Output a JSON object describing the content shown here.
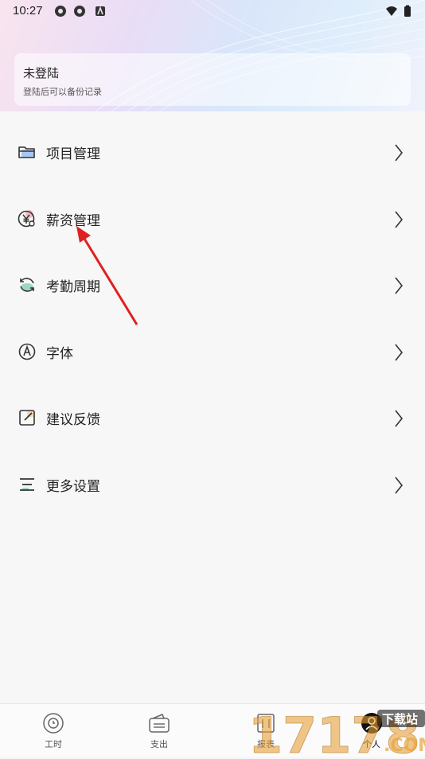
{
  "status_bar": {
    "time": "10:27"
  },
  "profile": {
    "title": "未登陆",
    "subtitle": "登陆后可以备份记录"
  },
  "menu": [
    {
      "label": "项目管理",
      "icon": "folder-icon"
    },
    {
      "label": "薪资管理",
      "icon": "yen-coin-icon"
    },
    {
      "label": "考勤周期",
      "icon": "cycle-icon"
    },
    {
      "label": "字体",
      "icon": "font-a-icon"
    },
    {
      "label": "建议反馈",
      "icon": "edit-note-icon"
    },
    {
      "label": "更多设置",
      "icon": "settings-lines-icon"
    }
  ],
  "bottom_nav": [
    {
      "label": "工时",
      "icon": "clock-icon"
    },
    {
      "label": "支出",
      "icon": "wallet-icon"
    },
    {
      "label": "报表",
      "icon": "report-icon"
    },
    {
      "label": "个人",
      "icon": "person-icon"
    }
  ],
  "watermark": {
    "text": "17178",
    "sub": "下载站",
    "domain": ".COM"
  },
  "colors": {
    "accent_red": "#e02020",
    "icon_stroke": "#333333",
    "icon_accent_green": "#9fd6c1",
    "icon_accent_pink": "#f3b8c4",
    "icon_accent_blue": "#a9c8f0"
  }
}
